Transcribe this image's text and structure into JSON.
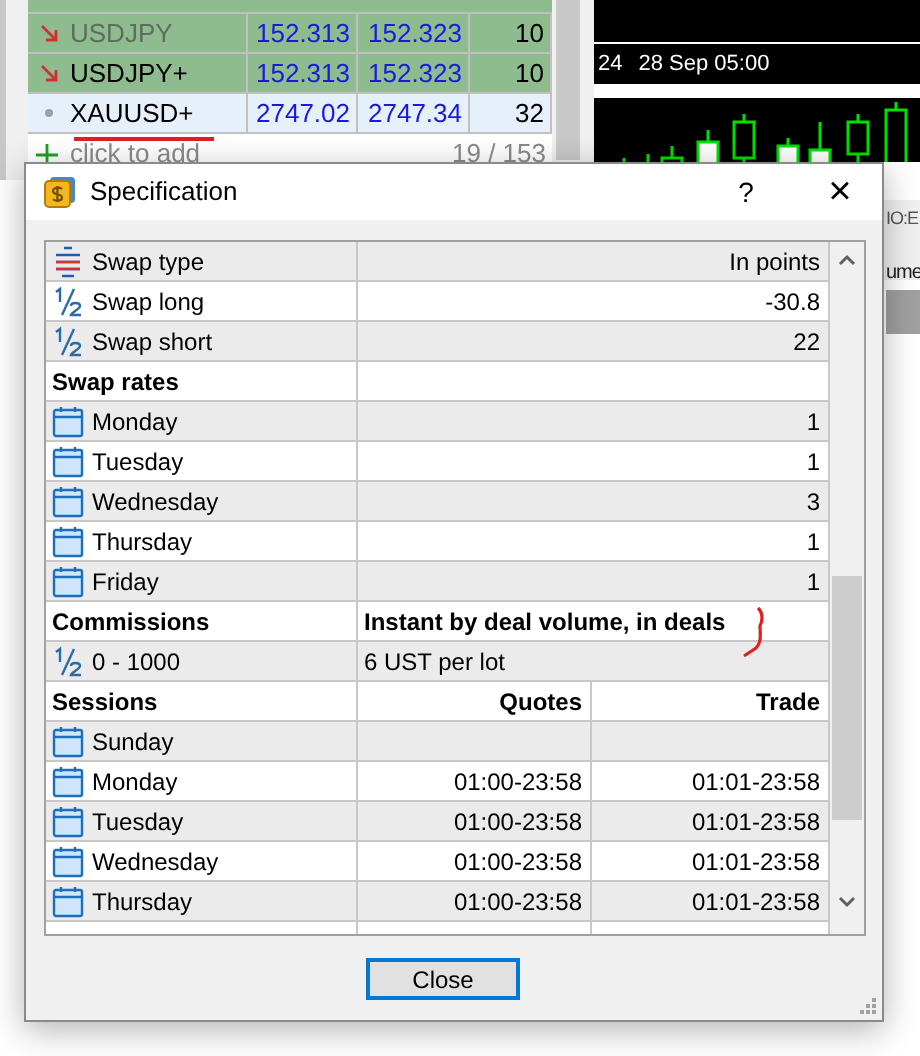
{
  "market_watch": {
    "rows": [
      {
        "symbol": "USDJPY",
        "bid": "152.313",
        "ask": "152.323",
        "spread": "10",
        "kind": "down",
        "disabled": true,
        "selected": false,
        "highlighted": true
      },
      {
        "symbol": "USDJPY+",
        "bid": "152.313",
        "ask": "152.323",
        "spread": "10",
        "kind": "down",
        "disabled": false,
        "selected": false,
        "highlighted": true
      },
      {
        "symbol": "XAUUSD+",
        "bid": "2747.02",
        "ask": "2747.34",
        "spread": "32",
        "kind": "flat",
        "disabled": false,
        "selected": true,
        "highlighted": false
      }
    ],
    "add_row": {
      "label": "click to add",
      "count": "19 / 153"
    }
  },
  "chart": {
    "time_labels": [
      "24",
      "28 Sep 05:00"
    ],
    "side_labels": [
      "IO:E",
      "ume"
    ]
  },
  "dialog": {
    "title": "Specification",
    "help": "?",
    "close_glyph": "×",
    "sections": [
      {
        "kind": "values",
        "rows": [
          {
            "kind": "list",
            "label": "Swap type",
            "values": [
              "In points"
            ]
          },
          {
            "kind": "fraction",
            "label": "Swap long",
            "values": [
              "-30.8"
            ]
          },
          {
            "kind": "fraction",
            "label": "Swap short",
            "values": [
              "22"
            ]
          }
        ]
      },
      {
        "kind": "values",
        "title": "Swap rates",
        "rows": [
          {
            "kind": "calendar",
            "label": "Monday",
            "values": [
              "1"
            ]
          },
          {
            "kind": "calendar",
            "label": "Tuesday",
            "values": [
              "1"
            ]
          },
          {
            "kind": "calendar",
            "label": "Wednesday",
            "values": [
              "3"
            ]
          },
          {
            "kind": "calendar",
            "label": "Thursday",
            "values": [
              "1"
            ]
          },
          {
            "kind": "calendar",
            "label": "Friday",
            "values": [
              "1"
            ]
          }
        ]
      },
      {
        "kind": "tiers",
        "title": "Commissions",
        "columns": [
          "Instant by deal volume, in deals"
        ],
        "rows": [
          {
            "kind": "fraction",
            "label": "0 - 1000",
            "values": [
              "6 UST per lot"
            ]
          }
        ]
      },
      {
        "kind": "sessions",
        "title": "Sessions",
        "columns": [
          "Quotes",
          "Trade"
        ],
        "rows": [
          {
            "kind": "calendar",
            "label": "Sunday"
          },
          {
            "kind": "calendar",
            "label": "Monday",
            "values": [
              "01:00-23:58",
              "01:01-23:58"
            ]
          },
          {
            "kind": "calendar",
            "label": "Tuesday",
            "values": [
              "01:00-23:58",
              "01:01-23:58"
            ]
          },
          {
            "kind": "calendar",
            "label": "Wednesday",
            "values": [
              "01:00-23:58",
              "01:01-23:58"
            ]
          },
          {
            "kind": "calendar",
            "label": "Thursday",
            "values": [
              "01:00-23:58",
              "01:01-23:58"
            ]
          }
        ]
      }
    ],
    "button": "Close"
  }
}
